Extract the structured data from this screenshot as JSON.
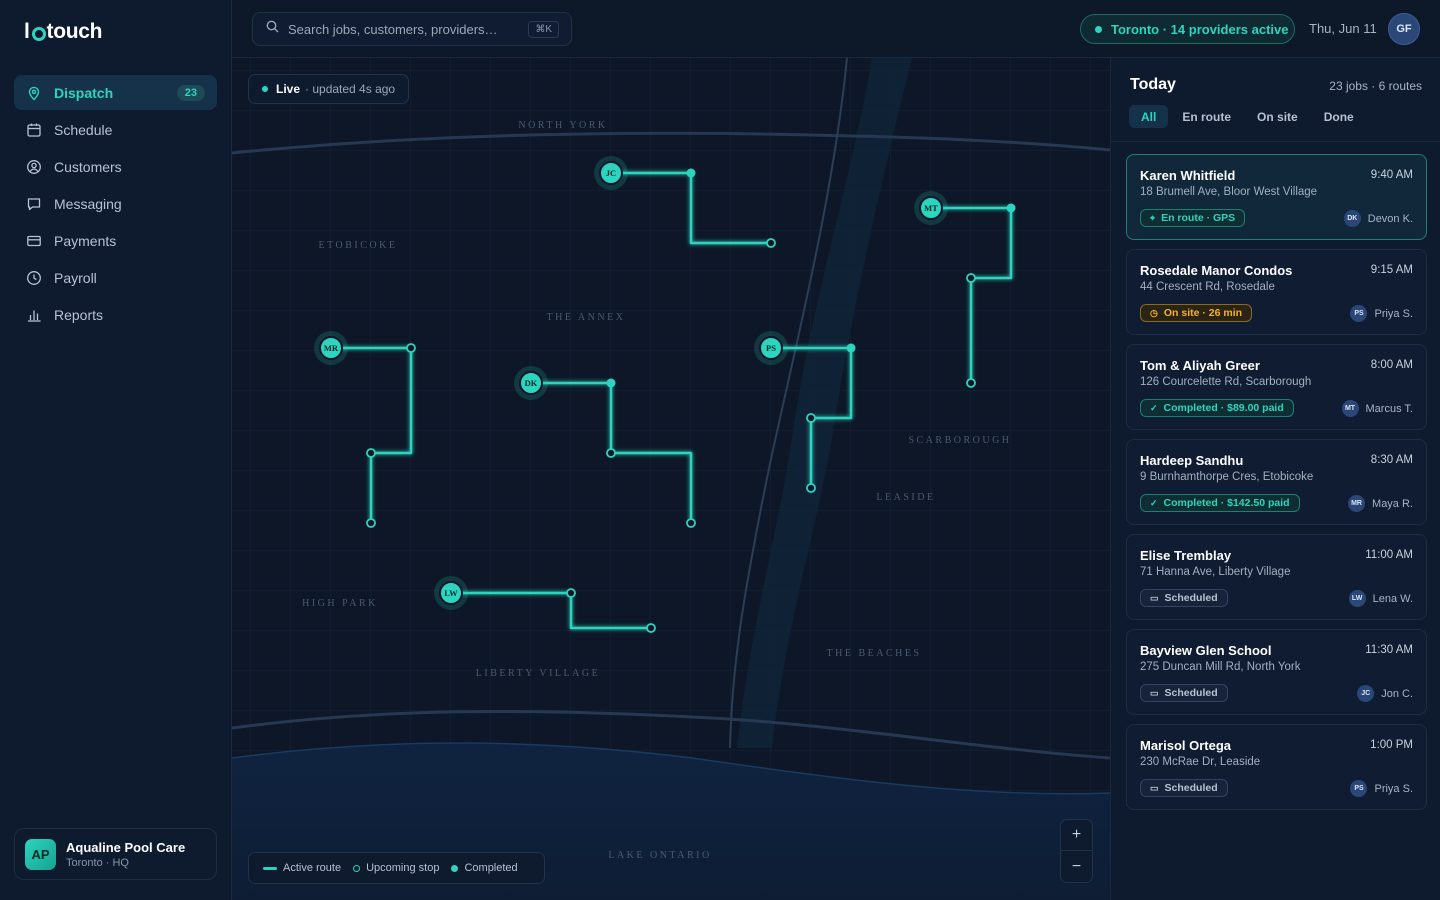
{
  "brand": {
    "logo_start": "l",
    "logo_end": "touch"
  },
  "sidebar": {
    "items": [
      {
        "label": "Dispatch",
        "badge": "23",
        "icon": "map-pin-icon"
      },
      {
        "label": "Schedule",
        "icon": "calendar-icon"
      },
      {
        "label": "Customers",
        "icon": "user-circle-icon"
      },
      {
        "label": "Messaging",
        "icon": "chat-icon"
      },
      {
        "label": "Payments",
        "icon": "credit-card-icon"
      },
      {
        "label": "Payroll",
        "icon": "clock-icon"
      },
      {
        "label": "Reports",
        "icon": "bar-chart-icon"
      }
    ],
    "org": {
      "initials": "AP",
      "name": "Aqualine Pool Care",
      "sub": "Toronto · HQ"
    }
  },
  "topbar": {
    "search_placeholder": "Search jobs, customers, providers…",
    "search_shortcut": "⌘K",
    "status_text": "Toronto · 14 providers active",
    "date": "Thu, Jun 11",
    "user_initials": "GF"
  },
  "map": {
    "live_label": "Live",
    "updated_text": "· updated 4s ago",
    "areas": [
      "NORTH YORK",
      "ETOBICOKE",
      "THE ANNEX",
      "SCARBOROUGH",
      "LEASIDE",
      "HIGH PARK",
      "LIBERTY VILLAGE",
      "THE BEACHES",
      "LAKE ONTARIO"
    ],
    "providers": [
      "JC",
      "MT",
      "MR",
      "DK",
      "PS",
      "LW"
    ],
    "legend": {
      "active": "Active route",
      "upcoming": "Upcoming stop",
      "completed": "Completed"
    },
    "zoom_in": "+",
    "zoom_out": "−",
    "accent": "#2dd4bf"
  },
  "panel": {
    "title": "Today",
    "meta": "23 jobs · 6 routes",
    "tabs": [
      "All",
      "En route",
      "On site",
      "Done"
    ],
    "jobs": [
      {
        "name": "Karen Whitfield",
        "time": "9:40 AM",
        "address": "18 Brumell Ave, Bloor West Village",
        "status": "En route · GPS",
        "status_icon": "pin-icon",
        "initials": "DK",
        "assignee": "Devon K."
      },
      {
        "name": "Rosedale Manor Condos",
        "time": "9:15 AM",
        "address": "44 Crescent Rd, Rosedale",
        "status": "On site · 26 min",
        "status_icon": "clock-icon",
        "initials": "PS",
        "assignee": "Priya S."
      },
      {
        "name": "Tom & Aliyah Greer",
        "time": "8:00 AM",
        "address": "126 Courcelette Rd, Scarborough",
        "status": "Completed · $89.00 paid",
        "status_icon": "check-icon",
        "initials": "MT",
        "assignee": "Marcus T."
      },
      {
        "name": "Hardeep Sandhu",
        "time": "8:30 AM",
        "address": "9 Burnhamthorpe Cres, Etobicoke",
        "status": "Completed · $142.50 paid",
        "status_icon": "check-icon",
        "initials": "MR",
        "assignee": "Maya R."
      },
      {
        "name": "Elise Tremblay",
        "time": "11:00 AM",
        "address": "71 Hanna Ave, Liberty Village",
        "status": "Scheduled",
        "status_icon": "calendar-icon",
        "initials": "LW",
        "assignee": "Lena W."
      },
      {
        "name": "Bayview Glen School",
        "time": "11:30 AM",
        "address": "275 Duncan Mill Rd, North York",
        "status": "Scheduled",
        "status_icon": "calendar-icon",
        "initials": "JC",
        "assignee": "Jon C."
      },
      {
        "name": "Marisol Ortega",
        "time": "1:00 PM",
        "address": "230 McRae Dr, Leaside",
        "status": "Scheduled",
        "status_icon": "calendar-icon",
        "initials": "PS",
        "assignee": "Priya S."
      }
    ]
  }
}
